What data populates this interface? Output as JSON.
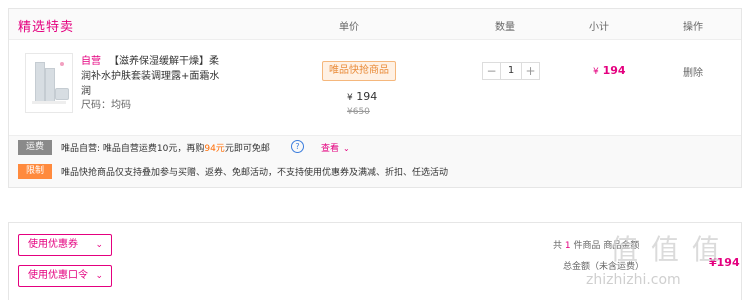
{
  "header": {
    "section_title": "精选特卖",
    "col_price": "单价",
    "col_qty": "数量",
    "col_subtotal": "小计",
    "col_action": "操作"
  },
  "item": {
    "self_tag": "自营",
    "name": "【滋养保湿缓解干燥】柔润补水护肤套装调理露+面霜水润",
    "size_label": "尺码：均码",
    "flash_badge": "唯品快抢商品",
    "price_yen": "¥",
    "price_now": "194",
    "price_old": "¥650",
    "quantity": "1",
    "minus": "−",
    "plus": "+",
    "subtotal_yen": "¥",
    "subtotal": "194",
    "delete_label": "删除"
  },
  "notes": {
    "shipping_tag": "运费",
    "shipping_pre": "唯品自营: 唯品自营运费10元，再购",
    "shipping_highlight": "94元",
    "shipping_post": "元即可免邮",
    "help_icon": "?",
    "check_label": "查看",
    "check_chevron": "⌄",
    "limit_tag": "限制",
    "limit_text": "唯品快抢商品仅支持叠加参与买赠、返券、免邮活动，不支持使用优惠券及满减、折扣、任选活动"
  },
  "summary": {
    "coupon_button": "使用优惠券",
    "coupon_code_button": "使用优惠口令",
    "chevron": "⌄",
    "count_pre": "共",
    "count_num": "1",
    "count_post": "件商品 商品金额",
    "total_label": "总金额（未含运费）",
    "total_value": "¥194"
  },
  "watermark": {
    "logo_text": "值 值 值",
    "url": "zhizhizhi.com"
  },
  "colors": {
    "brand": "#e4007f",
    "flash_orange": "#e98c3a",
    "limit_orange": "#ff8a3d",
    "ship_gray": "#8a8a8a",
    "link_blue": "#3b7ddd"
  }
}
